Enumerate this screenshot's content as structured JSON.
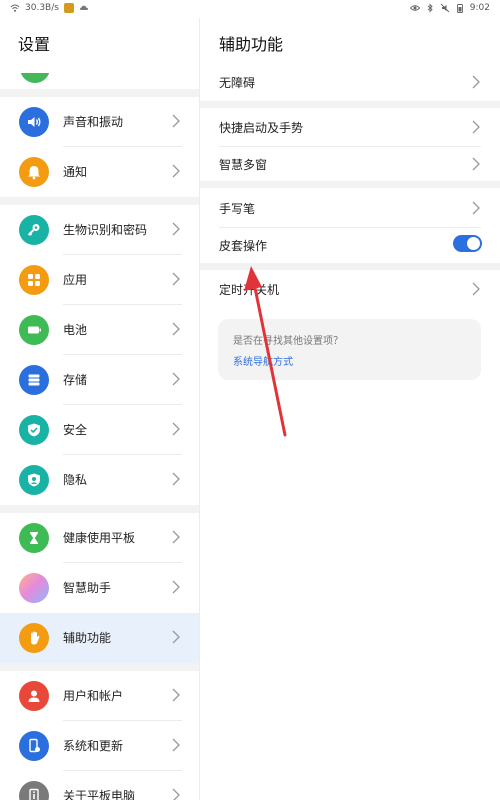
{
  "status_bar": {
    "network_speed": "30.3B/s",
    "time": "9:02"
  },
  "left": {
    "title": "设置",
    "items": [
      {
        "label": "声音和振动",
        "color": "#2b6fde",
        "icon": "volume-icon"
      },
      {
        "label": "通知",
        "color": "#f39c12",
        "icon": "bell-icon"
      },
      {
        "label": "生物识别和密码",
        "color": "#19b3a6",
        "icon": "key-icon"
      },
      {
        "label": "应用",
        "color": "#f39c12",
        "icon": "apps-grid-icon"
      },
      {
        "label": "电池",
        "color": "#3fbb55",
        "icon": "battery-icon"
      },
      {
        "label": "存储",
        "color": "#2b6fde",
        "icon": "storage-icon"
      },
      {
        "label": "安全",
        "color": "#19b3a6",
        "icon": "shield-check-icon"
      },
      {
        "label": "隐私",
        "color": "#19b3a6",
        "icon": "privacy-icon"
      },
      {
        "label": "健康使用平板",
        "color": "#3fbb55",
        "icon": "hourglass-icon"
      },
      {
        "label": "智慧助手",
        "color": "#c58ee0",
        "icon": "assistant-orb-icon"
      },
      {
        "label": "辅助功能",
        "color": "#f39c12",
        "icon": "hand-icon"
      },
      {
        "label": "用户和帐户",
        "color": "#e8473a",
        "icon": "user-icon"
      },
      {
        "label": "系统和更新",
        "color": "#2b6fde",
        "icon": "phone-update-icon"
      },
      {
        "label": "关于平板电脑",
        "color": "#7a7a7a",
        "icon": "info-icon"
      }
    ]
  },
  "right": {
    "title": "辅助功能",
    "rows": [
      {
        "label": "无障碍"
      },
      {
        "label": "快捷启动及手势"
      },
      {
        "label": "智慧多窗"
      },
      {
        "label": "手写笔"
      },
      {
        "label": "皮套操作"
      },
      {
        "label": "定时开关机"
      }
    ],
    "hint_question": "是否在寻找其他设置项？",
    "hint_link": "系统导航方式",
    "accent": "#2c6fe0"
  },
  "annotation": {
    "arrow_color": "#e0333a"
  }
}
